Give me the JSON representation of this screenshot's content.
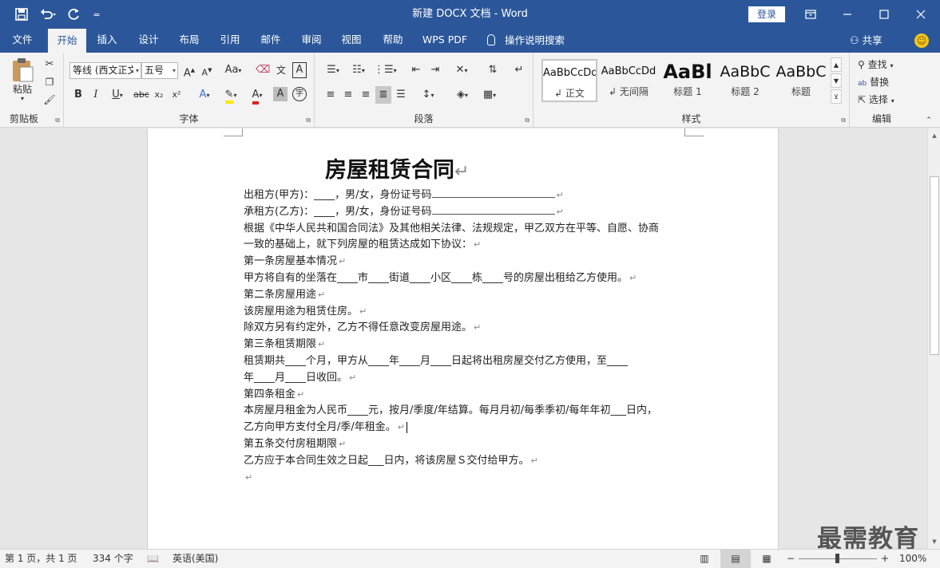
{
  "window": {
    "title": "新建 DOCX 文档  -  Word",
    "login_label": "登录"
  },
  "quick_access": {
    "more": "="
  },
  "tabs": [
    {
      "label": "文件"
    },
    {
      "label": "开始"
    },
    {
      "label": "插入"
    },
    {
      "label": "设计"
    },
    {
      "label": "布局"
    },
    {
      "label": "引用"
    },
    {
      "label": "邮件"
    },
    {
      "label": "审阅"
    },
    {
      "label": "视图"
    },
    {
      "label": "帮助"
    },
    {
      "label": "WPS PDF"
    }
  ],
  "tell_me": "操作说明搜索",
  "share_label": "共享",
  "ribbon": {
    "clipboard": {
      "paste_label": "粘贴",
      "group_label": "剪贴板"
    },
    "font": {
      "font_name": "等线 (西文正文)",
      "font_size": "五号",
      "group_label": "字体",
      "case_label": "Aa",
      "grow": "A",
      "shrink": "A",
      "bold": "B",
      "italic": "I",
      "underline": "U",
      "strike": "abc",
      "sub": "x₂",
      "sup": "x²",
      "pinyin_label": "文",
      "border_char": "A",
      "circle_char": "字"
    },
    "paragraph": {
      "group_label": "段落"
    },
    "styles": {
      "group_label": "样式",
      "items": [
        {
          "sample": "AaBbCcDd",
          "name": "正文"
        },
        {
          "sample": "AaBbCcDd",
          "name": "无间隔"
        },
        {
          "sample": "AaBl",
          "name": "标题 1"
        },
        {
          "sample": "AaBbC",
          "name": "标题 2"
        },
        {
          "sample": "AaBbC",
          "name": "标题"
        }
      ]
    },
    "editing": {
      "group_label": "编辑",
      "find": "查找",
      "replace": "替换",
      "select": "选择"
    }
  },
  "document": {
    "title": "房屋租赁合同",
    "lines": [
      "出租方(甲方)：____，男/女，身份证号码",
      "承租方(乙方)：____，男/女，身份证号码",
      "根据《中华人民共和国合同法》及其他相关法律、法规规定，甲乙双方在平等、自愿、协商",
      "一致的基础上，就下列房屋的租赁达成如下协议：",
      "第一条房屋基本情况",
      "甲方将自有的坐落在____市____街道____小区____栋____号的房屋出租给乙方使用。",
      "第二条房屋用途",
      "该房屋用途为租赁住房。",
      "除双方另有约定外，乙方不得任意改变房屋用途。",
      "第三条租赁期限",
      "租赁期共____个月，甲方从____年____月____日起将出租房屋交付乙方使用，至____",
      "年____月____日收回。",
      "第四条租金",
      "本房屋月租金为人民币____元，按月/季度/年结算。每月月初/每季季初/每年年初___日内，",
      "乙方向甲方支付全月/季/年租金。",
      "第五条交付房租期限",
      "乙方应于本合同生效之日起___日内，将该房屋Ｓ交付给甲方。",
      ""
    ]
  },
  "status": {
    "page": "第 1 页，共 1 页",
    "words": "334 个字",
    "language": "英语(美国)",
    "zoom": "100%"
  },
  "watermark": "最需教育"
}
